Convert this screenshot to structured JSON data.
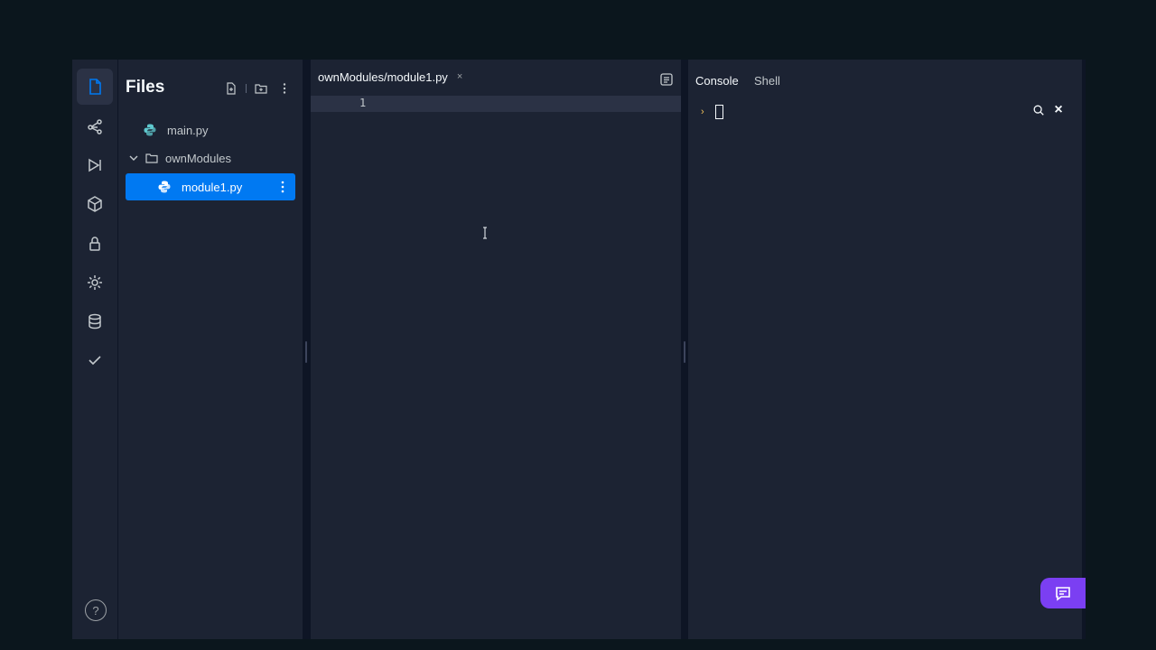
{
  "sidebar": {
    "icons": [
      "files-icon",
      "git-icon",
      "run-icon",
      "packages-icon",
      "secrets-icon",
      "settings-icon",
      "database-icon",
      "check-icon"
    ],
    "help_label": "?"
  },
  "files_panel": {
    "title": "Files",
    "tree": [
      {
        "label": "main.py",
        "type": "python-file"
      },
      {
        "label": "ownModules",
        "type": "folder",
        "expanded": true
      },
      {
        "label": "module1.py",
        "type": "python-file",
        "selected": true
      }
    ]
  },
  "editor": {
    "tab_label": "ownModules/module1.py",
    "close_label": "×",
    "line_numbers": [
      "1"
    ]
  },
  "console_panel": {
    "tabs": [
      "Console",
      "Shell"
    ],
    "prompt": "›",
    "close_label": "×"
  },
  "colors": {
    "accent": "#0079f2",
    "chat": "#7b3ff2",
    "python_icon": "#5fc8ce",
    "prompt": "#f0c05a"
  }
}
